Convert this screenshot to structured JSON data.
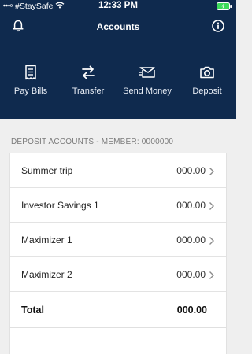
{
  "status_bar": {
    "carrier": "#StaySafe",
    "time": "12:33 PM"
  },
  "header": {
    "title": "Accounts",
    "background": "#0f2a4e",
    "left_icon": "bell-icon",
    "right_icon": "info-icon"
  },
  "actions": [
    {
      "label": "Pay Bills",
      "icon": "receipt-icon"
    },
    {
      "label": "Transfer",
      "icon": "transfer-arrows-icon"
    },
    {
      "label": "Send Money",
      "icon": "send-money-icon"
    },
    {
      "label": "Deposit",
      "icon": "camera-icon"
    }
  ],
  "section_label": "DEPOSIT ACCOUNTS - MEMBER: 0000000",
  "accounts": [
    {
      "name": "Summer trip",
      "amount": "000.00"
    },
    {
      "name": "Investor Savings 1",
      "amount": "000.00"
    },
    {
      "name": "Maximizer 1",
      "amount": "000.00"
    },
    {
      "name": "Maximizer 2",
      "amount": "000.00"
    }
  ],
  "total": {
    "label": "Total",
    "amount": "000.00"
  }
}
